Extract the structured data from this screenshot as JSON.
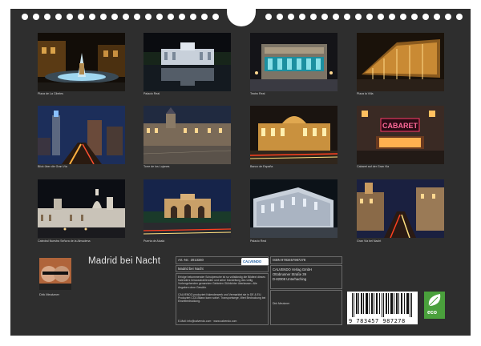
{
  "calendar": {
    "title": "Madrid bei Nacht",
    "author": "Dirk Meutzner"
  },
  "photos": [
    {
      "caption": "Plaza de La Cibeles",
      "scene": "fountain"
    },
    {
      "caption": "Palacio Real",
      "scene": "palace-reflection"
    },
    {
      "caption": "Teatro Real",
      "scene": "theatre"
    },
    {
      "caption": "Plaza la Villa",
      "scene": "glass-hall"
    },
    {
      "caption": "Blick über die Gran Via",
      "scene": "skyline"
    },
    {
      "caption": "Torre de los Lujanes",
      "scene": "plaza"
    },
    {
      "caption": "Banco de España",
      "scene": "bank"
    },
    {
      "caption": "Cabaret auf der Gran Via",
      "scene": "cabaret"
    },
    {
      "caption": "Catedral Nuestra Señora de la Almudena",
      "scene": "cathedral"
    },
    {
      "caption": "Puerta de Alcalá",
      "scene": "gate"
    },
    {
      "caption": "Palacio Real",
      "scene": "palace-side"
    },
    {
      "caption": "Gran Via bei Nacht",
      "scene": "gran-via"
    }
  ],
  "cabaret_sign": "CABARET",
  "info_box": {
    "article_label": "Art.-Nr.: 2013340",
    "isbn": "ISBN 9783457987278",
    "calendar_name": "Madrid bei Nacht",
    "publisher_lines": [
      "CALVENDO Verlag GmbH",
      "Ottobrunner Straße 39",
      "D-82008 Unterhaching"
    ],
    "calvendo_logo": "CALVENDO",
    "description": "Erfolge bekommender Schulpersche ist so vollständig die Bildtext dieses Kalenders herausstrahlenden und seine Darstellung des völlig Vorhergehenden genannten Gebieten Glühlichter überlassen. Alle Angaben ohne Gewähr.",
    "production_note": "CALVENDO produziert Kalenderwerk und Vermarktet sie in DE & EU. Produziert CO2-Bilanz kann sofort. Transportwege, Wert Bedruckung bei Einzelbedruckung.",
    "contact": "E-Mail: info@calvendo.com · www.calvendo.com",
    "author_label": "Dirk Meutzner",
    "barcode_number": "9 783457 987278",
    "eco_label": "eco"
  },
  "colors": {
    "background": "#2e2e2e",
    "page": "#ffffff",
    "eco_green": "#4aa03c",
    "calvendo_blue": "#1f5fa3"
  }
}
